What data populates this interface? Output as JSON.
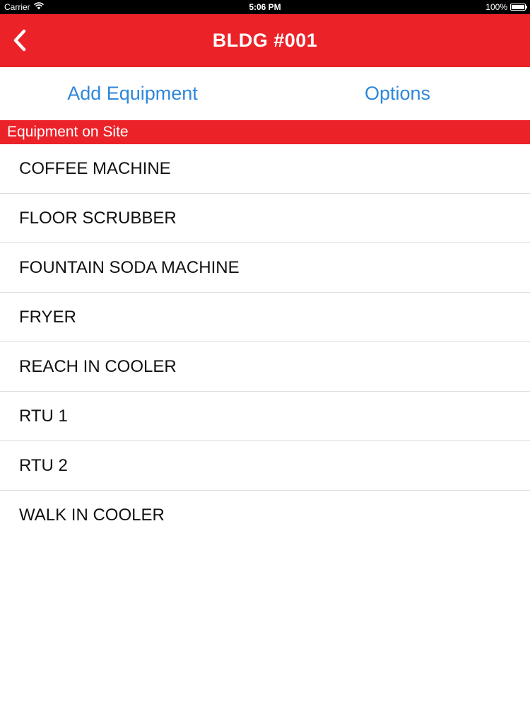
{
  "status_bar": {
    "carrier": "Carrier",
    "time": "5:06 PM",
    "battery": "100%",
    "battery_level": 1.0
  },
  "nav": {
    "back_icon": "chevron-left-icon",
    "title": "BLDG #001"
  },
  "actions": {
    "add_equipment": "Add Equipment",
    "options": "Options"
  },
  "section": {
    "header": "Equipment on Site"
  },
  "equipment": [
    "COFFEE MACHINE",
    "FLOOR SCRUBBER",
    "FOUNTAIN SODA MACHINE",
    "FRYER",
    "REACH IN COOLER",
    "RTU 1",
    "RTU 2",
    "WALK IN COOLER"
  ],
  "colors": {
    "brand_red": "#ec2229",
    "link_blue": "#2f87d9",
    "text": "#111111",
    "divider": "#dcdcdc"
  }
}
